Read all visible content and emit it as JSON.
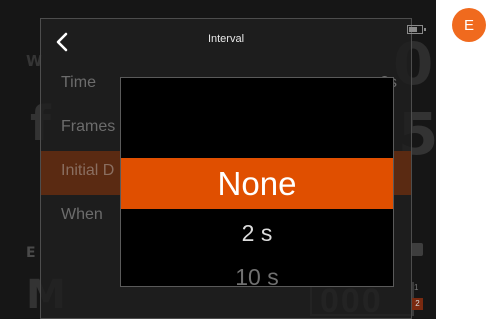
{
  "header": {
    "title": "Interval"
  },
  "menu": {
    "rows": [
      {
        "label": "Time",
        "value": "2s"
      },
      {
        "label": "Frames",
        "value": ""
      },
      {
        "label": "Initial D",
        "value": ""
      },
      {
        "label": "When",
        "value": ""
      }
    ]
  },
  "picker": {
    "options": [
      "None",
      "2 s",
      "10 s"
    ],
    "selected": "None"
  },
  "background": {
    "top_left_label": "W",
    "top_right_value": "0",
    "left_big": "f",
    "right_big": "5",
    "bottom_left_label": "E",
    "bottom_big": "M",
    "bottom_zeros": "000",
    "badge_one": "1",
    "badge_two": "2"
  },
  "side_badge": {
    "label": "E"
  },
  "colors": {
    "accent": "#e04f00",
    "badge": "#f06a1e",
    "screen_bg": "#161616"
  },
  "icons": {
    "back": "chevron-left-icon",
    "battery": "battery-icon"
  }
}
